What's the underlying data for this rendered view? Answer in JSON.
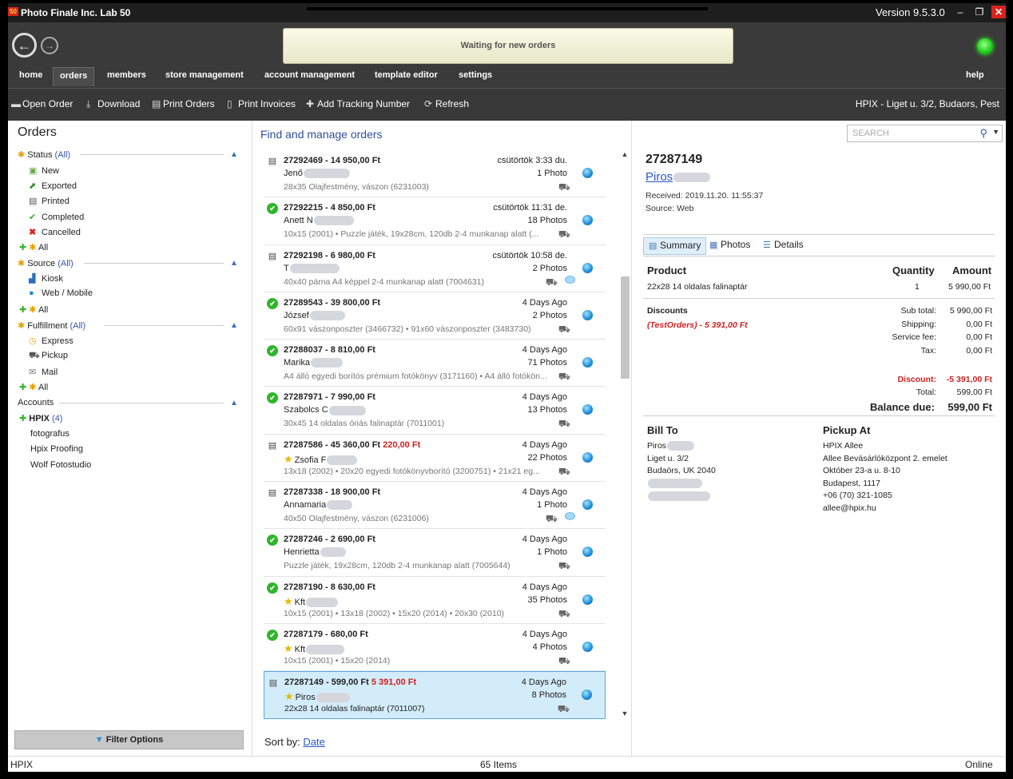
{
  "app": {
    "icon_text": "50",
    "title": "Photo Finale Inc. Lab 50",
    "version": "Version 9.5.3.0",
    "status_message": "Waiting for new orders"
  },
  "menu": [
    "home",
    "orders",
    "members",
    "store management",
    "account management",
    "template editor",
    "settings"
  ],
  "menu_help": "help",
  "toolbar": {
    "open_order": "Open Order",
    "download": "Download",
    "print_orders": "Print Orders",
    "print_invoices": "Print Invoices",
    "add_tracking": "Add Tracking Number",
    "refresh": "Refresh",
    "location": "HPIX - Liget u. 3/2, Budaors, Pest"
  },
  "left": {
    "title": "Orders",
    "status_label": "Status",
    "status_all": "(All)",
    "status_items": [
      "New",
      "Exported",
      "Printed",
      "Completed",
      "Cancelled",
      "All"
    ],
    "source_label": "Source",
    "source_all": "(All)",
    "source_items": [
      "Kiosk",
      "Web / Mobile",
      "All"
    ],
    "fulfillment_label": "Fulfillment",
    "fulfillment_all": "(All)",
    "fulfillment_items": [
      "Express",
      "Pickup",
      "Mail",
      "All"
    ],
    "accounts_label": "Accounts",
    "accounts_main": "HPIX",
    "accounts_count": "(4)",
    "accounts_items": [
      "fotografus",
      "Hpix Proofing",
      "Wolf Fotostudio"
    ],
    "filter_button": "Filter Options"
  },
  "middle": {
    "title": "Find and manage orders",
    "sort_label": "Sort by:",
    "sort_value": "Date",
    "orders": [
      {
        "status": "printed",
        "head": "27292469 - 14 950,00 Ft",
        "extra": "",
        "time": "csütörtök 3:33 du.",
        "name": "Jenő",
        "photos": "1 Photo",
        "desc": "28x35 Olajfestmény, vászon (6231003)",
        "star": false,
        "bubble": false
      },
      {
        "status": "completed",
        "head": "27292215 - 4 850,00 Ft",
        "extra": "",
        "time": "csütörtök 11:31 de.",
        "name": "Anett N",
        "photos": "18 Photos",
        "desc": "10x15 (2001) • Puzzle játék, 19x28cm, 120db 2-4 munkanap alatt (...",
        "star": false,
        "bubble": false
      },
      {
        "status": "printed",
        "head": "27292198 - 6 980,00 Ft",
        "extra": "",
        "time": "csütörtök 10:58 de.",
        "name": "T",
        "photos": "2 Photos",
        "desc": "40x40 párna A4 képpel 2-4 munkanap alatt (7004631)",
        "star": false,
        "bubble": true
      },
      {
        "status": "completed",
        "head": "27289543 - 39 800,00 Ft",
        "extra": "",
        "time": "4 Days Ago",
        "name": "József",
        "photos": "2 Photos",
        "desc": "60x91 vászonposzter (3466732) • 91x60 vászonposzter (3483730)",
        "star": false,
        "bubble": false
      },
      {
        "status": "completed",
        "head": "27288037 - 8 810,00 Ft",
        "extra": "",
        "time": "4 Days Ago",
        "name": "Marika",
        "photos": "71 Photos",
        "desc": "A4 álló egyedi borítós prémium fotókönyv (3171160) • A4 álló fotókön...",
        "star": false,
        "bubble": false
      },
      {
        "status": "completed",
        "head": "27287971 - 7 990,00 Ft",
        "extra": "",
        "time": "4 Days Ago",
        "name": "Szabolcs C",
        "photos": "13 Photos",
        "desc": "30x45 14 oldalas óriás falinaptár (7011001)",
        "star": false,
        "bubble": false
      },
      {
        "status": "printed",
        "head": "27287586 - 45 360,00 Ft",
        "extra": "220,00 Ft",
        "time": "4 Days Ago",
        "name": "Zsofia F",
        "photos": "22 Photos",
        "desc": "13x18 (2002) • 20x20 egyedi fotókönyvborító (3200751) • 21x21 eg...",
        "star": true,
        "bubble": false
      },
      {
        "status": "printed",
        "head": "27287338 - 18 900,00 Ft",
        "extra": "",
        "time": "4 Days Ago",
        "name": "Annamaria",
        "photos": "1 Photo",
        "desc": "40x50 Olajfestmény, vászon (6231006)",
        "star": false,
        "bubble": true
      },
      {
        "status": "completed",
        "head": "27287246 - 2 690,00 Ft",
        "extra": "",
        "time": "4 Days Ago",
        "name": "Henrietta",
        "photos": "1 Photo",
        "desc": "Puzzle játék, 19x28cm, 120db 2-4 munkanap alatt (7005644)",
        "star": false,
        "bubble": false
      },
      {
        "status": "completed",
        "head": "27287190 - 8 630,00 Ft",
        "extra": "",
        "time": "4 Days Ago",
        "name": "Kft",
        "photos": "35 Photos",
        "desc": "10x15 (2001) • 13x18 (2002) • 15x20 (2014) • 20x30 (2010)",
        "star": true,
        "bubble": false
      },
      {
        "status": "completed",
        "head": "27287179 - 680,00 Ft",
        "extra": "",
        "time": "4 Days Ago",
        "name": "Kft",
        "photos": "4 Photos",
        "desc": "10x15 (2001) • 15x20 (2014)",
        "star": true,
        "bubble": false
      },
      {
        "status": "printed",
        "head": "27287149 - 599,00 Ft",
        "extra": "5 391,00 Ft",
        "time": "4 Days Ago",
        "name": "Piros",
        "photos": "8 Photos",
        "desc": "22x28 14 oldalas falinaptár (7011007)",
        "star": true,
        "bubble": false,
        "selected": true
      }
    ]
  },
  "detail": {
    "search_placeholder": "SEARCH",
    "order_id": "27287149",
    "customer": "Piros",
    "received": "Received: 2019.11.20. 11:55:37",
    "source": "Source: Web",
    "tabs": [
      "Summary",
      "Photos",
      "Details"
    ],
    "product_head": "Product",
    "quantity_head": "Quantity",
    "amount_head": "Amount",
    "product": "22x28 14 oldalas falinaptár",
    "product_qty": "1",
    "product_amount": "5 990,00 Ft",
    "discounts_head": "Discounts",
    "discount_line": "(TestOrders) - 5 391,00 Ft",
    "subtotal_label": "Sub total:",
    "subtotal": "5 990,00 Ft",
    "shipping_label": "Shipping:",
    "shipping": "0,00 Ft",
    "service_label": "Service fee:",
    "service": "0,00 Ft",
    "tax_label": "Tax:",
    "tax": "0,00 Ft",
    "discount_label": "Discount:",
    "discount": "-5 391,00 Ft",
    "total_label": "Total:",
    "total": "599,00 Ft",
    "balance_label": "Balance due:",
    "balance": "599,00 Ft",
    "bill_to_head": "Bill To",
    "bill_to": [
      "Piros",
      "Liget u. 3/2",
      "Budaörs, UK 2040"
    ],
    "pickup_head": "Pickup At",
    "pickup": [
      "HPIX Allee",
      "Allee Bevásárlóközpont 2. emelet",
      "Október 23-a u. 8-10",
      "Budapest,  1117",
      "+06 (70) 321-1085",
      "allee@hpix.hu"
    ]
  },
  "statusbar": {
    "left": "HPIX",
    "center": "65 Items",
    "right": "Online"
  }
}
